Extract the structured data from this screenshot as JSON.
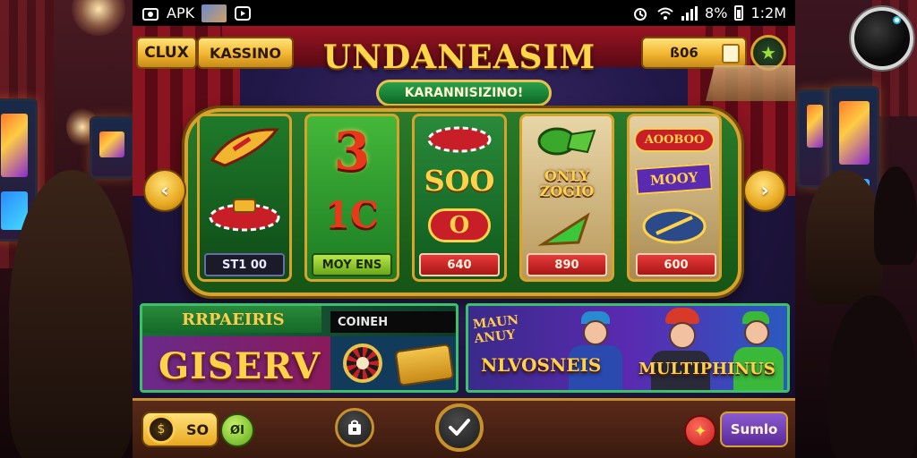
{
  "status_bar": {
    "app_label": "APK",
    "battery": "8%",
    "time": "1:2M"
  },
  "header": {
    "btn_club": "CLUX",
    "btn_kasino": "KASSINO",
    "title": "UNDANEASIM",
    "balance": "ß06",
    "subtitle": "KARANNISIZINO!"
  },
  "reels": [
    {
      "top": "",
      "mid": "",
      "plate": "ST1 00"
    },
    {
      "top": "3",
      "mid": "1C",
      "plate": "MOY ENS"
    },
    {
      "top": "",
      "mid": "SOO",
      "bottom": "O",
      "plate": "640"
    },
    {
      "top": "",
      "mid": "ONLY ZOGIO",
      "plate": "890"
    },
    {
      "top": "AOOBOO",
      "mid": "MOOY",
      "plate": "600"
    }
  ],
  "panels": {
    "left_head": "RRPAEIRIS",
    "left_tag": "COINEH",
    "left_promo": "GISERV",
    "right_label": "MAUN ANUY",
    "right_game_a": "NLVOSNEIS",
    "right_game_b": "MULTIPHINUS"
  },
  "bottom": {
    "coins": "SO",
    "gem": "ØI",
    "mode": "Sumlo"
  },
  "colors": {
    "gold": "#f2b530",
    "felt_green": "#1a7a22",
    "accent_red": "#c81e28"
  }
}
